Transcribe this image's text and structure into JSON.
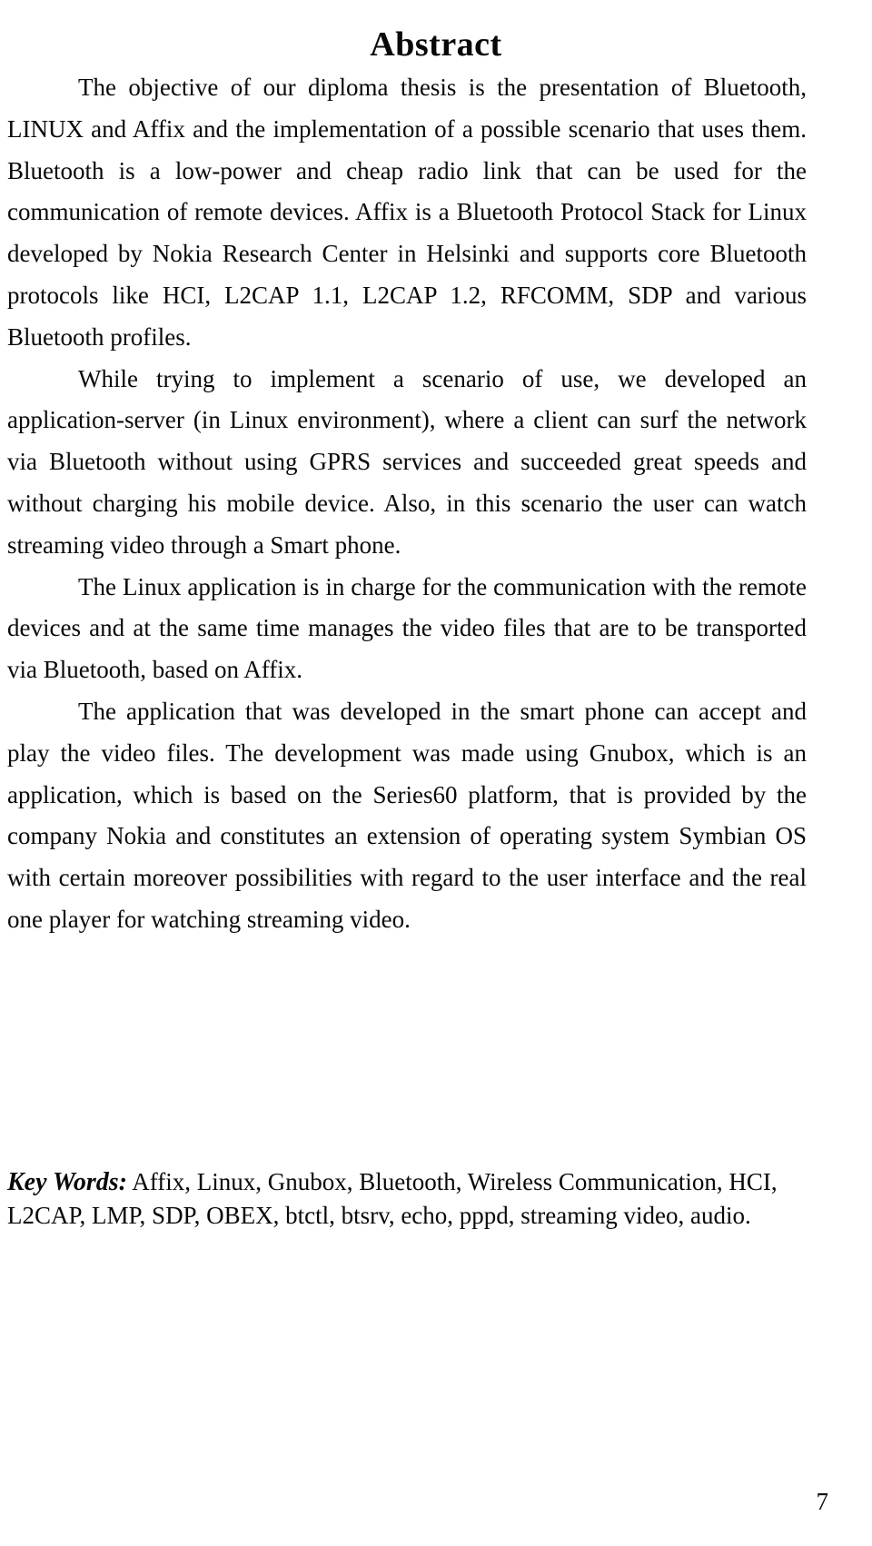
{
  "document": {
    "heading": "Abstract",
    "page_number": "7",
    "paragraphs": [
      "The objective of our diploma thesis is the presentation of Bluetooth, LINUX and Affix and the implementation of a possible scenario that uses them. Bluetooth is a low-power and cheap radio link that can be used for the communication of remote devices. Affix is a Bluetooth Protocol Stack for Linux developed by Nokia Research Center in Helsinki and supports core Bluetooth protocols like HCI, L2CAP 1.1, L2CAP 1.2, RFCOMM, SDP and various Bluetooth profiles.",
      "While trying to implement a scenario of use, we developed an application-server (in Linux environment), where a client can surf the network via Bluetooth without using GPRS services and succeeded great speeds and without charging his mobile device. Also, in this scenario the user can watch streaming video through a Smart phone.",
      "The Linux application is in charge for the communication with the remote devices and   at the same time manages the video files that are to be transported via Bluetooth, based on Affix.",
      "The application that was developed in the smart phone can accept and play the video files. The development was made using  Gnubox, which is an application, which is based on the Series60 platform, that is provided by the company Nokia and constitutes an extension of operating system Symbian OS with certain moreover possibilities with regard to the user interface and the real one player for watching streaming video."
    ],
    "keywords": {
      "label": "Key Words:",
      "list": "Affix, Linux, Gnubox, Bluetooth, Wireless Communication, HCI, L2CAP, LMP, SDP, OBEX, btctl, btsrv, echo, pppd, streaming video, audio."
    }
  }
}
